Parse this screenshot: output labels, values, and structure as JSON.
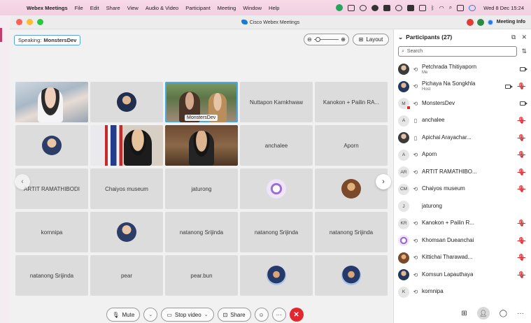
{
  "menubar": {
    "app_name": "Webex Meetings",
    "items": [
      "File",
      "Edit",
      "Share",
      "View",
      "Audio & Video",
      "Participant",
      "Meeting",
      "Window",
      "Help"
    ],
    "clock": "Wed 8 Dec 15:24"
  },
  "window": {
    "title": "Cisco Webex Meetings",
    "meeting_info": "Meeting Info"
  },
  "stage": {
    "speaking_label": "Speaking:",
    "speaking_name": "MonstersDev",
    "layout_label": "Layout",
    "tiles": [
      {
        "name": "",
        "kind": "video-a"
      },
      {
        "name": "",
        "kind": "avatar",
        "avatar": "dark"
      },
      {
        "name": "MonstersDev",
        "kind": "video-c",
        "active": true
      },
      {
        "name": "Nuttapon Karnkhwaw",
        "kind": "text"
      },
      {
        "name": "Kanokon + Pailin RA...",
        "kind": "text"
      },
      {
        "name": "",
        "kind": "avatar",
        "avatar": "normal"
      },
      {
        "name": "",
        "kind": "video-d"
      },
      {
        "name": "",
        "kind": "video-e"
      },
      {
        "name": "anchalee",
        "kind": "text"
      },
      {
        "name": "Aporn",
        "kind": "text"
      },
      {
        "name": "ARTIT RAMATHIBODI",
        "kind": "text"
      },
      {
        "name": "Chaiyos museum",
        "kind": "text"
      },
      {
        "name": "jaturong",
        "kind": "text"
      },
      {
        "name": "",
        "kind": "avatar",
        "avatar": "flower"
      },
      {
        "name": "",
        "kind": "avatar",
        "avatar": "warm"
      },
      {
        "name": "kornnipa",
        "kind": "text"
      },
      {
        "name": "",
        "kind": "avatar",
        "avatar": "normal"
      },
      {
        "name": "natanong Srijinda",
        "kind": "text"
      },
      {
        "name": "natanong Srijinda",
        "kind": "text"
      },
      {
        "name": "natanong Srijinda",
        "kind": "text"
      },
      {
        "name": "natanong Srijinda",
        "kind": "text"
      },
      {
        "name": "pear",
        "kind": "text"
      },
      {
        "name": "pear.bun",
        "kind": "text"
      },
      {
        "name": "",
        "kind": "avatar",
        "avatar": "cap"
      },
      {
        "name": "",
        "kind": "avatar",
        "avatar": "cap"
      }
    ]
  },
  "controls": {
    "mute": "Mute",
    "stop_video": "Stop video",
    "share": "Share",
    "end_glyph": "✕"
  },
  "participants": {
    "title": "Participants (27)",
    "search_placeholder": "Search",
    "list": [
      {
        "initials": "",
        "avatar": "photo",
        "device": "⟲",
        "name": "Petchrada Thitiyaporn",
        "sub": "Me",
        "camera": true,
        "muted": false
      },
      {
        "initials": "",
        "avatar": "photo2",
        "device": "⟲",
        "name": "Pichaya Na Songkhla",
        "sub": "Host",
        "camera": true,
        "muted": true
      },
      {
        "initials": "M",
        "avatar": "badge",
        "device": "⟲",
        "name": "MonstersDev",
        "sub": "",
        "camera": true,
        "muted": false
      },
      {
        "initials": "A",
        "avatar": "",
        "device": "▯",
        "name": "anchalee",
        "sub": "",
        "camera": false,
        "muted": true
      },
      {
        "initials": "",
        "avatar": "photo",
        "device": "▯",
        "name": "Apichai Arayachar...",
        "sub": "",
        "camera": false,
        "muted": true
      },
      {
        "initials": "A",
        "avatar": "",
        "device": "⟲",
        "name": "Aporn",
        "sub": "",
        "camera": false,
        "muted": true
      },
      {
        "initials": "AR",
        "avatar": "",
        "device": "⟲",
        "name": "ARTIT RAMATHIBO...",
        "sub": "",
        "camera": false,
        "muted": true
      },
      {
        "initials": "CM",
        "avatar": "",
        "device": "⟲",
        "name": "Chaiyos museum",
        "sub": "",
        "camera": false,
        "muted": true
      },
      {
        "initials": "J",
        "avatar": "",
        "device": "",
        "name": "jaturong",
        "sub": "",
        "camera": false,
        "muted": false
      },
      {
        "initials": "KR",
        "avatar": "",
        "device": "⟲",
        "name": "Kanokon + Pailin R...",
        "sub": "",
        "camera": false,
        "muted": true
      },
      {
        "initials": "",
        "avatar": "flower",
        "device": "⟲",
        "name": "Khomsan Dueanchai",
        "sub": "",
        "camera": false,
        "muted": true
      },
      {
        "initials": "",
        "avatar": "warm",
        "device": "⟲",
        "name": "Kittichai Tharawad...",
        "sub": "",
        "camera": false,
        "muted": true
      },
      {
        "initials": "",
        "avatar": "photo2",
        "device": "⟲",
        "name": "Komsun Lapauthaya",
        "sub": "",
        "camera": false,
        "muted": true
      },
      {
        "initials": "K",
        "avatar": "",
        "device": "⟲",
        "name": "kornnipa",
        "sub": "",
        "camera": false,
        "muted": false
      }
    ]
  },
  "colors": {
    "accent": "#47a9e4",
    "end_call": "#e3272f",
    "muted": "#e3272f"
  }
}
